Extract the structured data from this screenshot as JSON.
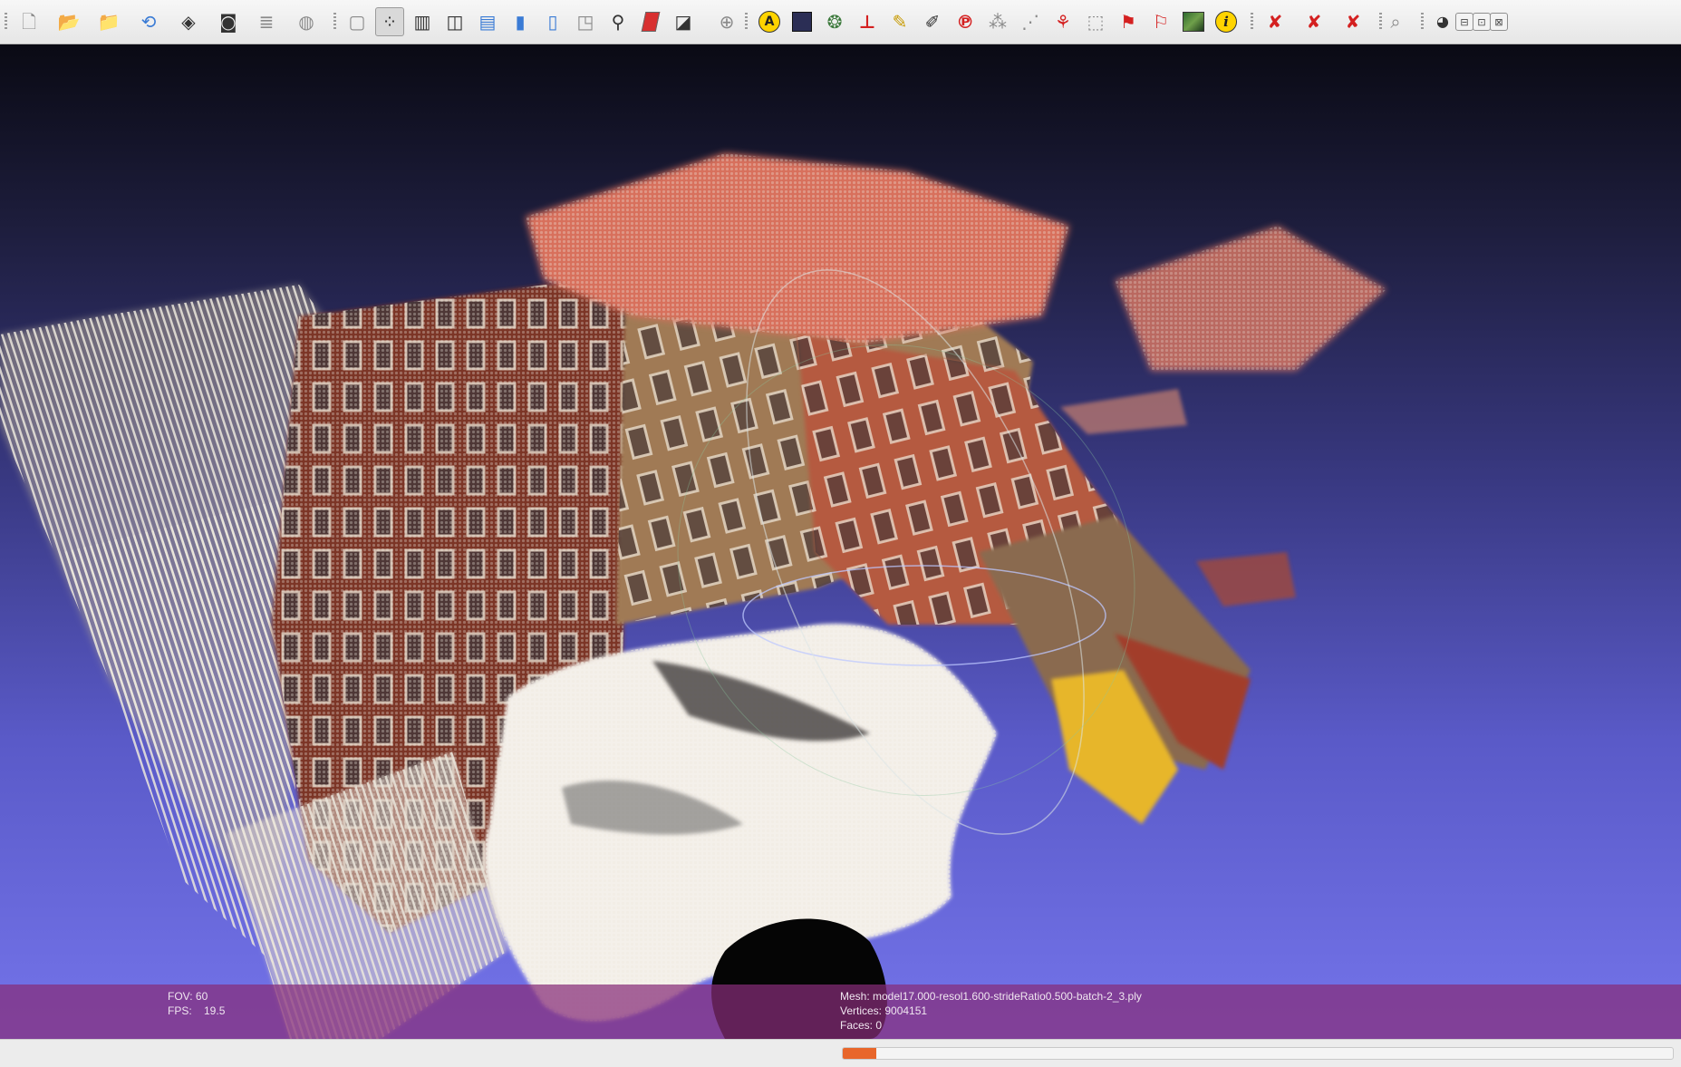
{
  "toolbar": {
    "icons": [
      "new-document-icon",
      "open-folder-icon",
      "open-project-icon",
      "reload-icon",
      "save-project-icon",
      "snapshot-icon",
      "layers-icon",
      "sphere-render-icon",
      "bounding-box-icon",
      "points-render-icon",
      "wireframe-icon",
      "hidden-lines-icon",
      "flat-lines-icon",
      "flat-shading-icon",
      "smooth-shading-icon",
      "texture-icon",
      "light-icon",
      "fancy-lighting-icon",
      "double-side-icon",
      "backface-icon",
      "annotation-a-icon",
      "raster-icon",
      "mesh-texture-icon",
      "measure-icon",
      "color-paint-icon",
      "brush-icon",
      "pick-points-icon",
      "select-vertices-icon",
      "select-faces-icon",
      "quality-mapper-icon",
      "select-region-icon",
      "align-icon",
      "manipulator-icon",
      "heightmap-icon",
      "info-icon",
      "delete-vertices-icon",
      "delete-faces-icon",
      "delete-all-icon",
      "search-icon",
      "eye-icon"
    ],
    "window_controls": {
      "minimize": "⊟",
      "restore": "⊡",
      "close": "⊠"
    }
  },
  "viewport": {
    "background_top": "#0a0a14",
    "background_bottom": "#7474ea"
  },
  "info": {
    "fov": "FOV: 60",
    "fps": "FPS:    19.5",
    "mesh": "Mesh: model17.000-resol1.600-strideRatio0.500-batch-2_3.ply",
    "vertices": "Vertices: 9004151",
    "faces": "Faces: 0"
  },
  "status": {
    "progress": 0.004
  },
  "colors": {
    "overlay": "#872d78",
    "progress": "#e8662a"
  }
}
